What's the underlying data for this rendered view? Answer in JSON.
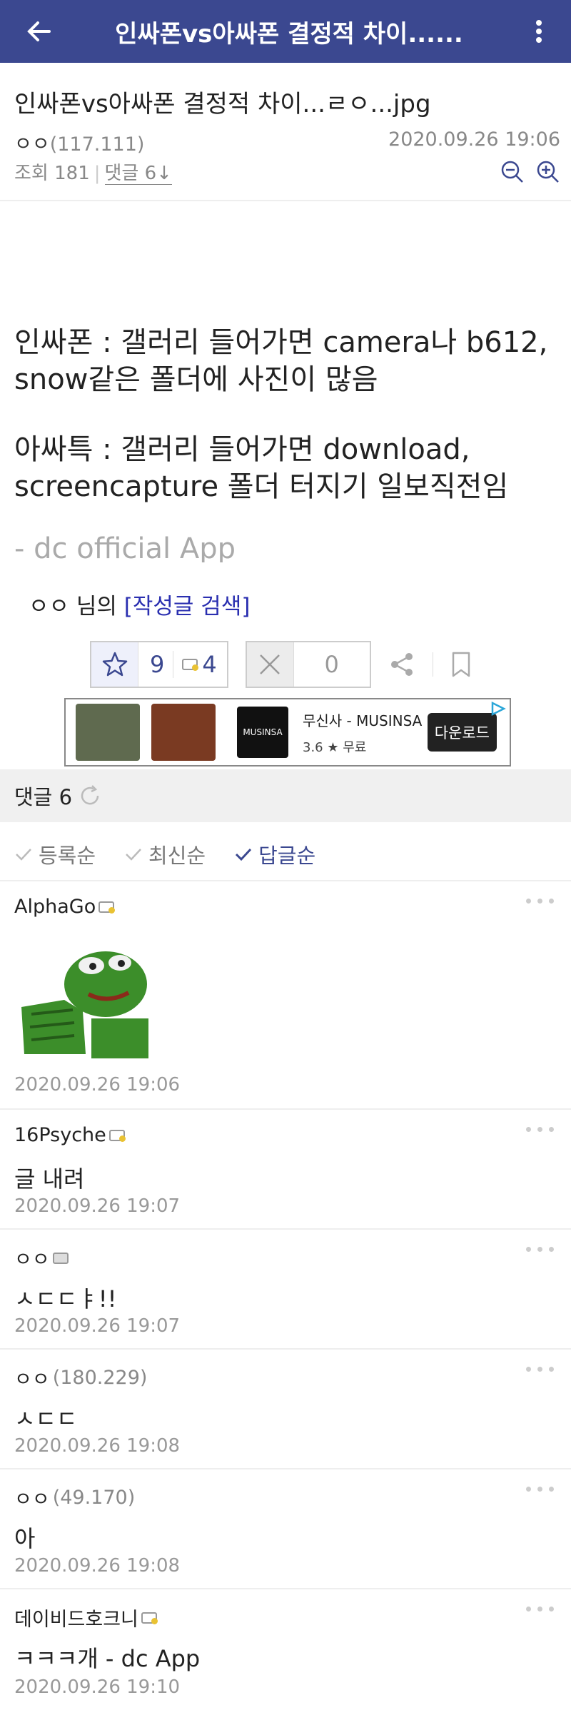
{
  "appbar": {
    "title": "인싸폰vs아싸폰 결정적 차이......"
  },
  "post": {
    "title": "인싸폰vs아싸폰 결정적 차이...ㄹㅇ...jpg",
    "author": "ㅇㅇ",
    "ip": "(117.111)",
    "datetime": "2020.09.26 19:06",
    "views_label": "조회 181",
    "comments_label": "댓글 6↓",
    "body": [
      "인싸폰 : 갤러리 들어가면 camera나 b612, snow같은 폴더에 사진이 많음",
      "아싸특 : 갤러리 들어가면 download, screencapture 폴더 터지기 일보직전임"
    ],
    "signature": "- dc official App",
    "author_search_prefix": "ㅇㅇ 님의",
    "author_search_link": "[작성글 검색]"
  },
  "vote": {
    "up": "9",
    "fix": "4",
    "down": "0"
  },
  "ad": {
    "logo_text": "MUSINSA",
    "name": "무신사 - MUSINSA",
    "rating": "3.6 ★ 무료",
    "download_label": "다운로드"
  },
  "comments_header": {
    "label": "댓글 6"
  },
  "sort": {
    "options": [
      "등록순",
      "최신순",
      "답글순"
    ]
  },
  "comments": [
    {
      "nick": "AlphaGo",
      "ip": "",
      "text": "",
      "date": "2020.09.26 19:06"
    },
    {
      "nick": "16Psyche",
      "ip": "",
      "text": "글 내려",
      "date": "2020.09.26 19:07"
    },
    {
      "nick": "ㅇㅇ",
      "ip": "",
      "text": "ㅅㄷㄷㅑ!!",
      "date": "2020.09.26 19:07"
    },
    {
      "nick": "ㅇㅇ",
      "ip": "(180.229)",
      "text": "ㅅㄷㄷ",
      "date": "2020.09.26 19:08"
    },
    {
      "nick": "ㅇㅇ",
      "ip": "(49.170)",
      "text": "아",
      "date": "2020.09.26 19:08"
    },
    {
      "nick": "데이비드호크니",
      "ip": "",
      "text": "ㅋㅋㅋ개 - dc App",
      "date": "2020.09.26 19:10"
    }
  ],
  "colors": {
    "accent": "#3b4890",
    "link": "#2a2fb0"
  }
}
